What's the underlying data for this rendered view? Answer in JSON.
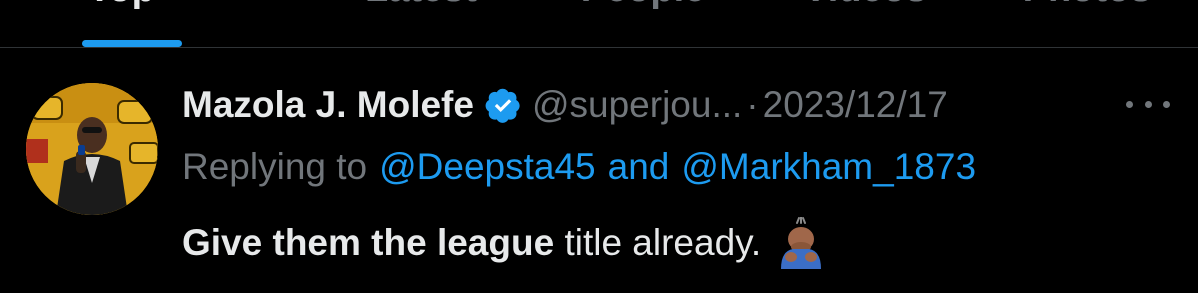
{
  "tabs": [
    {
      "label": "Top",
      "active": true
    },
    {
      "label": "Latest",
      "active": false
    },
    {
      "label": "People",
      "active": false
    },
    {
      "label": "Videos",
      "active": false
    },
    {
      "label": "Photos",
      "active": false
    }
  ],
  "tweet": {
    "display_name": "Mazola J. Molefe",
    "handle": "@superjou...",
    "separator": "·",
    "date": "2023/12/17",
    "reply": {
      "prefix": "Replying to",
      "mention1": "@Deepsta45",
      "and": "and",
      "mention2": "@Markham_1873"
    },
    "text_bold": "Give them the league",
    "text_regular": " title already.",
    "emoji": "person-bowing-emoji"
  },
  "colors": {
    "background": "#000000",
    "accent": "#1d9bf0",
    "muted": "#71767b",
    "text": "#e7e9ea"
  },
  "icons": [
    "verified-badge-icon",
    "more-options-icon"
  ]
}
